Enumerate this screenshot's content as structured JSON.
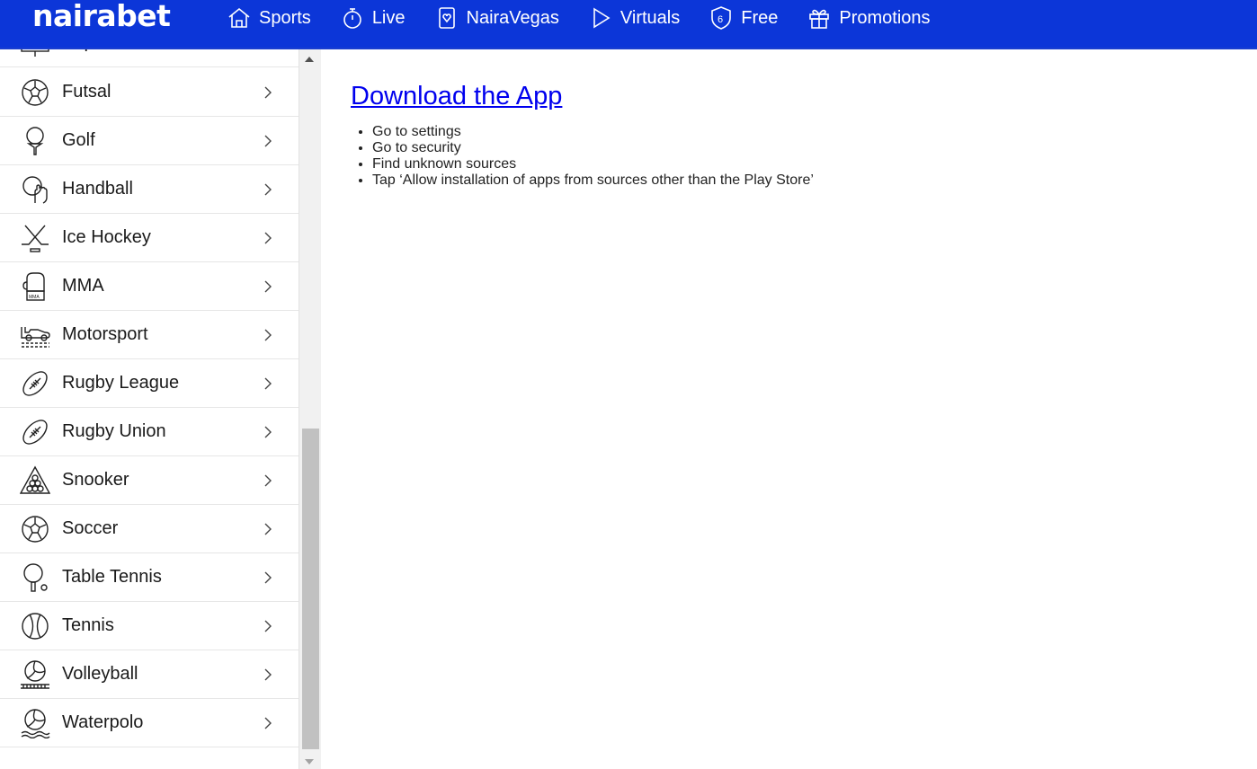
{
  "brand": {
    "logo": "nairabet",
    "color": "#0c36d8"
  },
  "nav": [
    {
      "label": "Sports",
      "icon": "home-icon"
    },
    {
      "label": "Live",
      "icon": "stopwatch-icon"
    },
    {
      "label": "NairaVegas",
      "icon": "card-icon"
    },
    {
      "label": "Virtuals",
      "icon": "play-icon"
    },
    {
      "label": "Free",
      "icon": "shield-6-icon"
    },
    {
      "label": "Promotions",
      "icon": "gift-icon"
    }
  ],
  "sidebar": {
    "partial_item": "eSports",
    "items": [
      {
        "label": "Futsal",
        "icon": "soccer-ball-icon"
      },
      {
        "label": "Golf",
        "icon": "golf-tee-icon"
      },
      {
        "label": "Handball",
        "icon": "handball-icon"
      },
      {
        "label": "Ice Hockey",
        "icon": "hockey-sticks-icon"
      },
      {
        "label": "MMA",
        "icon": "boxing-glove-icon"
      },
      {
        "label": "Motorsport",
        "icon": "race-car-icon"
      },
      {
        "label": "Rugby League",
        "icon": "rugby-ball-icon"
      },
      {
        "label": "Rugby Union",
        "icon": "rugby-ball-icon"
      },
      {
        "label": "Snooker",
        "icon": "snooker-triangle-icon"
      },
      {
        "label": "Soccer",
        "icon": "soccer-ball-icon"
      },
      {
        "label": "Table Tennis",
        "icon": "table-tennis-icon"
      },
      {
        "label": "Tennis",
        "icon": "tennis-ball-icon"
      },
      {
        "label": "Volleyball",
        "icon": "volleyball-icon"
      },
      {
        "label": "Waterpolo",
        "icon": "waterpolo-icon"
      }
    ]
  },
  "main": {
    "title": "Download the App",
    "steps": [
      "Go to settings",
      "Go to security",
      "Find unknown sources",
      "Tap ‘Allow installation of apps from sources other than the Play Store’"
    ]
  }
}
